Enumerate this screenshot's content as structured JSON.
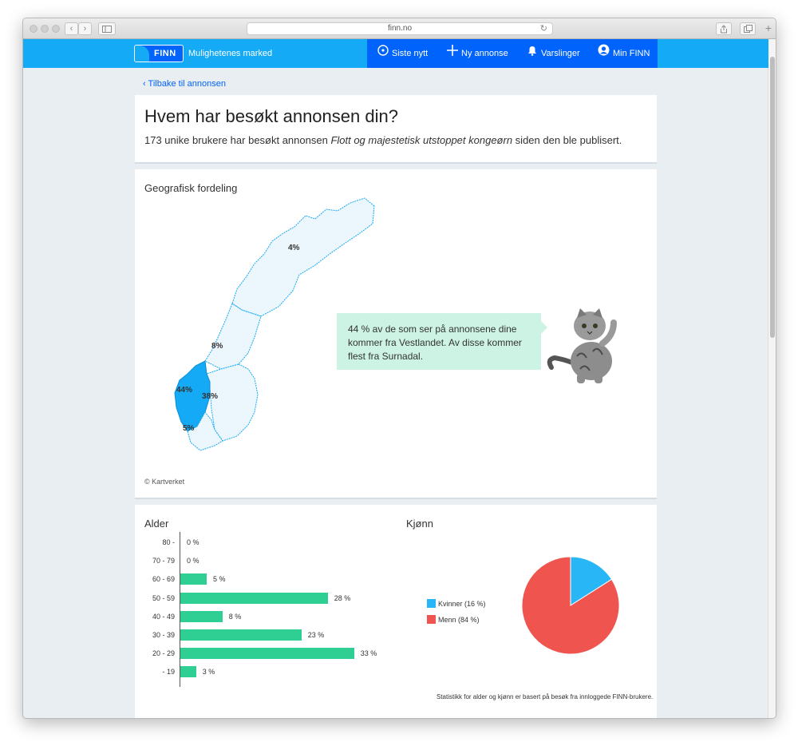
{
  "browser": {
    "url": "finn.no",
    "reload_icon": "reload-icon",
    "share_icon": "share-icon",
    "tabs_icon": "tabs-icon",
    "new_tab": "+"
  },
  "header": {
    "logo_text": "FINN",
    "tagline": "Mulighetenes marked",
    "nav": [
      {
        "label": "Siste nytt",
        "icon": "clock-icon"
      },
      {
        "label": "Ny annonse",
        "icon": "plus-icon"
      },
      {
        "label": "Varslinger",
        "icon": "bell-icon"
      },
      {
        "label": "Min FINN",
        "icon": "user-icon"
      }
    ],
    "brand_color": "#14aaf5",
    "nav_color": "#0063fb"
  },
  "back_link": "Tilbake til annonsen",
  "page": {
    "title": "Hvem har besøkt annonsen din?",
    "sub_before": "173 unike brukere har besøkt annonsen ",
    "sub_ad": "Flott og majestetisk utstoppet kongeørn",
    "sub_after": " siden den ble publisert."
  },
  "geo": {
    "title": "Geografisk fordeling",
    "labels": [
      "4%",
      "8%",
      "44%",
      "38%",
      "5%"
    ],
    "bubble": "44 % av de som ser på annonsene dine kommer fra Vestlandet. Av disse kommer flest fra Surnadal.",
    "credit": "© Kartverket",
    "map_fill": "#ecf6fd",
    "highlight_fill": "#14aaf5"
  },
  "age": {
    "title": "Alder"
  },
  "gender": {
    "title": "Kjønn",
    "legend": [
      "Kvinner (16 %)",
      "Menn (84 %)"
    ],
    "colors": [
      "#29b6f6",
      "#f0544f"
    ]
  },
  "footnote": "Statistikk for alder og kjønn er basert på besøk fra innloggede FINN-brukere.",
  "chart_data": [
    {
      "type": "bar",
      "orientation": "horizontal",
      "title": "Alder",
      "categories": [
        "80 -",
        "70 - 79",
        "60 - 69",
        "50 - 59",
        "40 - 49",
        "30 - 39",
        "20 - 29",
        "- 19"
      ],
      "values": [
        0,
        0,
        5,
        28,
        8,
        23,
        33,
        3
      ],
      "value_labels": [
        "0 %",
        "0 %",
        "5 %",
        "28 %",
        "8 %",
        "23 %",
        "33 %",
        "3 %"
      ],
      "unit": "%",
      "color": "#2fcf93"
    },
    {
      "type": "pie",
      "title": "Kjønn",
      "labels": [
        "Kvinner (16 %)",
        "Menn (84 %)"
      ],
      "values": [
        16,
        84
      ],
      "colors": [
        "#29b6f6",
        "#f0544f"
      ],
      "legend": "left"
    }
  ]
}
